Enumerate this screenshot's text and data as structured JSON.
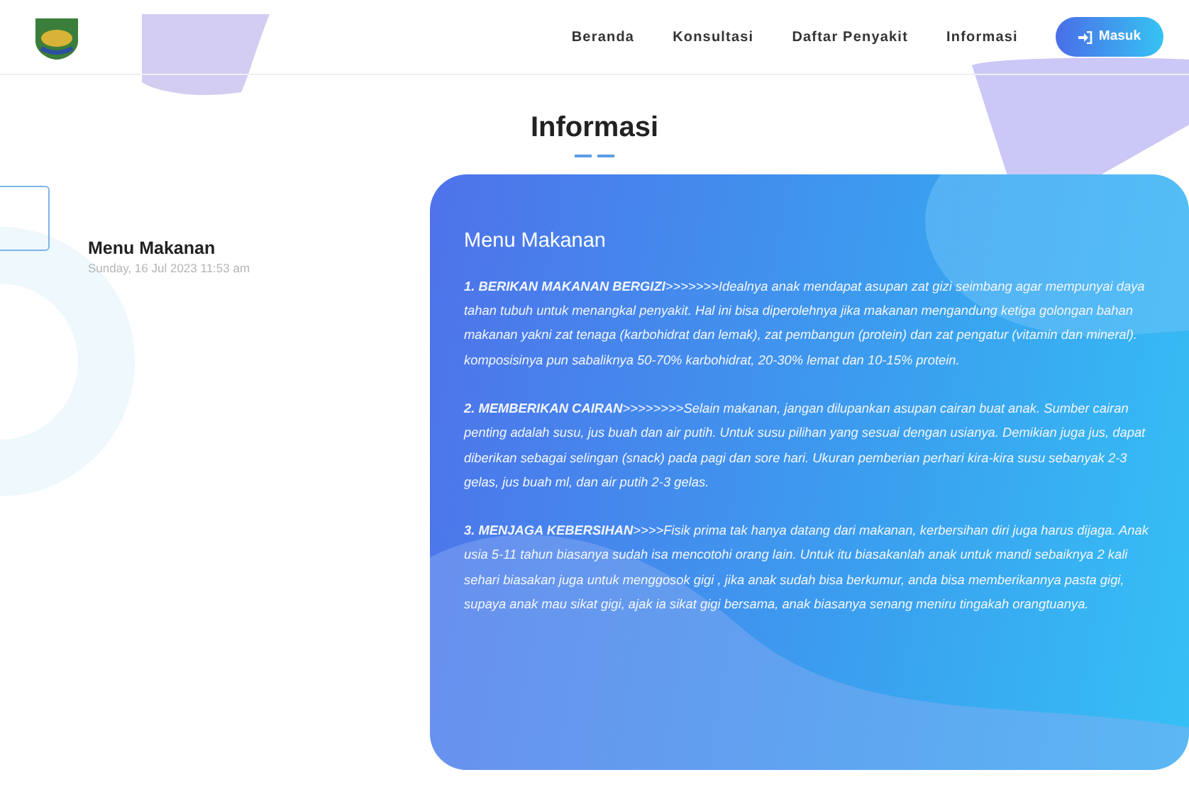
{
  "navbar": {
    "links": [
      {
        "label": "Beranda"
      },
      {
        "label": "Konsultasi"
      },
      {
        "label": "Daftar Penyakit"
      },
      {
        "label": "Informasi"
      }
    ],
    "login_button": {
      "label": "Masuk"
    }
  },
  "page_title": "Informasi",
  "sidebar": {
    "items": [
      {
        "title": "Menu Makanan",
        "date": "Sunday, 16 Jul 2023 11:53 am"
      }
    ]
  },
  "article": {
    "title": "Menu Makanan",
    "paragraphs": [
      "**1. BERIKAN MAKANAN BERGIZI**>>>>>>>Idealnya anak mendapat asupan zat gizi seimbang agar mempunyai daya tahan tubuh untuk menangkal penyakit. Hal ini bisa diperolehnya jika makanan mengandung ketiga golongan bahan makanan yakni zat tenaga (karbohidrat dan lemak), zat pembangun (protein) dan zat pengatur (vitamin dan mineral). komposisinya pun sabaliknya 50-70% karbohidrat, 20-30% lemat dan 10-15% protein.",
      "**2. MEMBERIKAN CAIRAN**>>>>>>>>Selain makanan, jangan dilupankan asupan cairan buat anak. Sumber cairan penting adalah susu, jus buah dan air putih. Untuk susu pilihan yang sesuai dengan usianya. Demikian juga jus, dapat diberikan sebagai selingan (snack) pada pagi dan sore hari. Ukuran pemberian perhari kira-kira susu sebanyak 2-3 gelas, jus buah ml, dan air putih 2-3 gelas.",
      "**3. MENJAGA KEBERSIHAN**>>>>Fisik prima tak hanya datang dari makanan, kerbersihan diri juga harus dijaga. Anak usia 5-11 tahun biasanya sudah isa mencotohi orang lain. Untuk itu biasakanlah anak untuk mandi sebaiknya 2 kali sehari biasakan juga untuk menggosok gigi , jika anak sudah bisa berkumur, anda bisa memberikannya pasta gigi, supaya anak mau sikat gigi, ajak ia sikat gigi bersama, anak biasanya senang meniru tingakah orangtuanya."
    ]
  }
}
